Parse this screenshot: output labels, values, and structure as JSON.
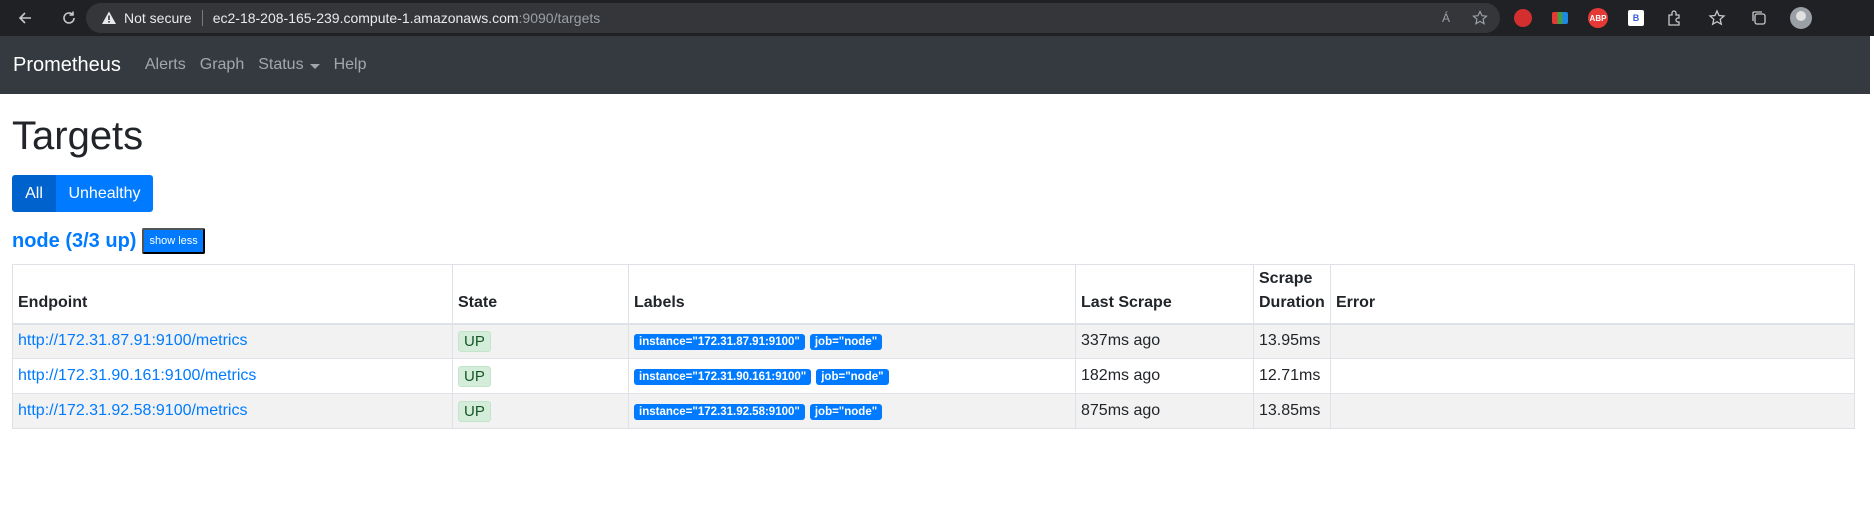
{
  "browser": {
    "not_secure": "Not secure",
    "url_host": "ec2-18-208-165-239.compute-1.amazonaws.com",
    "url_path": ":9090/targets",
    "read_aloud_icon": "Á",
    "ext_b_label": "B",
    "ext_abp_label": "ABP"
  },
  "navbar": {
    "brand": "Prometheus",
    "links": [
      "Alerts",
      "Graph",
      "Status",
      "Help"
    ]
  },
  "page": {
    "title": "Targets",
    "filter_all": "All",
    "filter_unhealthy": "Unhealthy",
    "job_title": "node (3/3 up)",
    "toggle_label": "show less"
  },
  "table": {
    "headers": {
      "endpoint": "Endpoint",
      "state": "State",
      "labels": "Labels",
      "last_scrape": "Last Scrape",
      "scrape_duration_1": "Scrape",
      "scrape_duration_2": "Duration",
      "error": "Error"
    },
    "rows": [
      {
        "endpoint": "http://172.31.87.91:9100/metrics",
        "state": "UP",
        "instance": "instance=\"172.31.87.91:9100\"",
        "job": "job=\"node\"",
        "last_scrape": "337ms ago",
        "duration": "13.95ms",
        "error": ""
      },
      {
        "endpoint": "http://172.31.90.161:9100/metrics",
        "state": "UP",
        "instance": "instance=\"172.31.90.161:9100\"",
        "job": "job=\"node\"",
        "last_scrape": "182ms ago",
        "duration": "12.71ms",
        "error": ""
      },
      {
        "endpoint": "http://172.31.92.58:9100/metrics",
        "state": "UP",
        "instance": "instance=\"172.31.92.58:9100\"",
        "job": "job=\"node\"",
        "last_scrape": "875ms ago",
        "duration": "13.85ms",
        "error": ""
      }
    ]
  },
  "colors": {
    "navbar_bg": "#343a40",
    "primary": "#007bff",
    "success_bg": "#d4edda",
    "success_text": "#155724"
  }
}
